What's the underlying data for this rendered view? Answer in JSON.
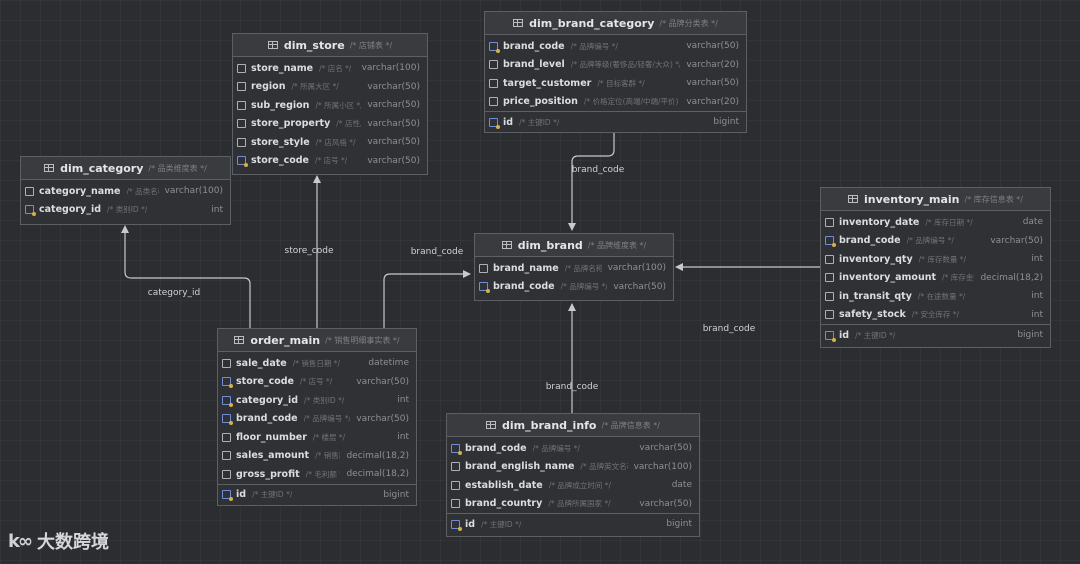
{
  "entities": {
    "dim_store": {
      "name": "dim_store",
      "comment": "/* 店铺表 */",
      "columns": [
        {
          "name": "store_name",
          "comment": "/* 店名 */",
          "type": "varchar(100)"
        },
        {
          "name": "region",
          "comment": "/* 所属大区 */",
          "type": "varchar(50)"
        },
        {
          "name": "sub_region",
          "comment": "/* 所属小区 */",
          "type": "varchar(50)"
        },
        {
          "name": "store_property",
          "comment": "/* 店性质 */",
          "type": "varchar(50)"
        },
        {
          "name": "store_style",
          "comment": "/* 店风格 */",
          "type": "varchar(50)"
        },
        {
          "name": "store_code",
          "comment": "/* 店号 */",
          "type": "varchar(50)"
        }
      ]
    },
    "dim_brand_category": {
      "name": "dim_brand_category",
      "comment": "/* 品牌分类表 */",
      "columns": [
        {
          "name": "brand_code",
          "comment": "/* 品牌编号 */",
          "type": "varchar(50)"
        },
        {
          "name": "brand_level",
          "comment": "/* 品牌等级(奢侈品/轻奢/大众) */",
          "type": "varchar(20)"
        },
        {
          "name": "target_customer",
          "comment": "/* 目标客群 */",
          "type": "varchar(50)"
        },
        {
          "name": "price_position",
          "comment": "/* 价格定位(高端/中端/平价) */",
          "type": "varchar(20)"
        }
      ],
      "pk": {
        "name": "id",
        "comment": "/* 主键ID */",
        "type": "bigint"
      }
    },
    "dim_category": {
      "name": "dim_category",
      "comment": "/* 品类维度表 */",
      "columns": [
        {
          "name": "category_name",
          "comment": "/* 品类名称 */",
          "type": "varchar(100)"
        },
        {
          "name": "category_id",
          "comment": "/* 类别ID */",
          "type": "int"
        }
      ]
    },
    "dim_brand": {
      "name": "dim_brand",
      "comment": "/* 品牌维度表 */",
      "columns": [
        {
          "name": "brand_name",
          "comment": "/* 品牌名称 */",
          "type": "varchar(100)"
        },
        {
          "name": "brand_code",
          "comment": "/* 品牌编号 */",
          "type": "varchar(50)"
        }
      ]
    },
    "inventory_main": {
      "name": "inventory_main",
      "comment": "/* 库存信息表 */",
      "columns": [
        {
          "name": "inventory_date",
          "comment": "/* 库存日期 */",
          "type": "date"
        },
        {
          "name": "brand_code",
          "comment": "/* 品牌编号 */",
          "type": "varchar(50)"
        },
        {
          "name": "inventory_qty",
          "comment": "/* 库存数量 */",
          "type": "int"
        },
        {
          "name": "inventory_amount",
          "comment": "/* 库存金额 */",
          "type": "decimal(18,2)"
        },
        {
          "name": "in_transit_qty",
          "comment": "/* 在途数量 */",
          "type": "int"
        },
        {
          "name": "safety_stock",
          "comment": "/* 安全库存 */",
          "type": "int"
        }
      ],
      "pk": {
        "name": "id",
        "comment": "/* 主键ID */",
        "type": "bigint"
      }
    },
    "order_main": {
      "name": "order_main",
      "comment": "/* 销售明细事实表 */",
      "columns": [
        {
          "name": "sale_date",
          "comment": "/* 销售日期 */",
          "type": "datetime"
        },
        {
          "name": "store_code",
          "comment": "/* 店号 */",
          "type": "varchar(50)"
        },
        {
          "name": "category_id",
          "comment": "/* 类别ID */",
          "type": "int"
        },
        {
          "name": "brand_code",
          "comment": "/* 品牌编号 */",
          "type": "varchar(50)"
        },
        {
          "name": "floor_number",
          "comment": "/* 楼层 */",
          "type": "int"
        },
        {
          "name": "sales_amount",
          "comment": "/* 销售额 */",
          "type": "decimal(18,2)"
        },
        {
          "name": "gross_profit",
          "comment": "/* 毛利额 */",
          "type": "decimal(18,2)"
        }
      ],
      "pk": {
        "name": "id",
        "comment": "/* 主键ID */",
        "type": "bigint"
      }
    },
    "dim_brand_info": {
      "name": "dim_brand_info",
      "comment": "/* 品牌信息表 */",
      "columns": [
        {
          "name": "brand_code",
          "comment": "/* 品牌编号 */",
          "type": "varchar(50)"
        },
        {
          "name": "brand_english_name",
          "comment": "/* 品牌英文名称 */",
          "type": "varchar(100)"
        },
        {
          "name": "establish_date",
          "comment": "/* 品牌成立时间 */",
          "type": "date"
        },
        {
          "name": "brand_country",
          "comment": "/* 品牌所属国家 */",
          "type": "varchar(50)"
        }
      ],
      "pk": {
        "name": "id",
        "comment": "/* 主键ID */",
        "type": "bigint"
      }
    }
  },
  "edges": {
    "brand_category_to_brand": "brand_code",
    "order_to_store": "store_code",
    "order_to_brand": "brand_code",
    "order_to_category": "category_id",
    "inventory_to_brand": "brand_code",
    "brand_info_to_brand": "brand_code"
  },
  "watermark": {
    "text": "大数跨境"
  }
}
